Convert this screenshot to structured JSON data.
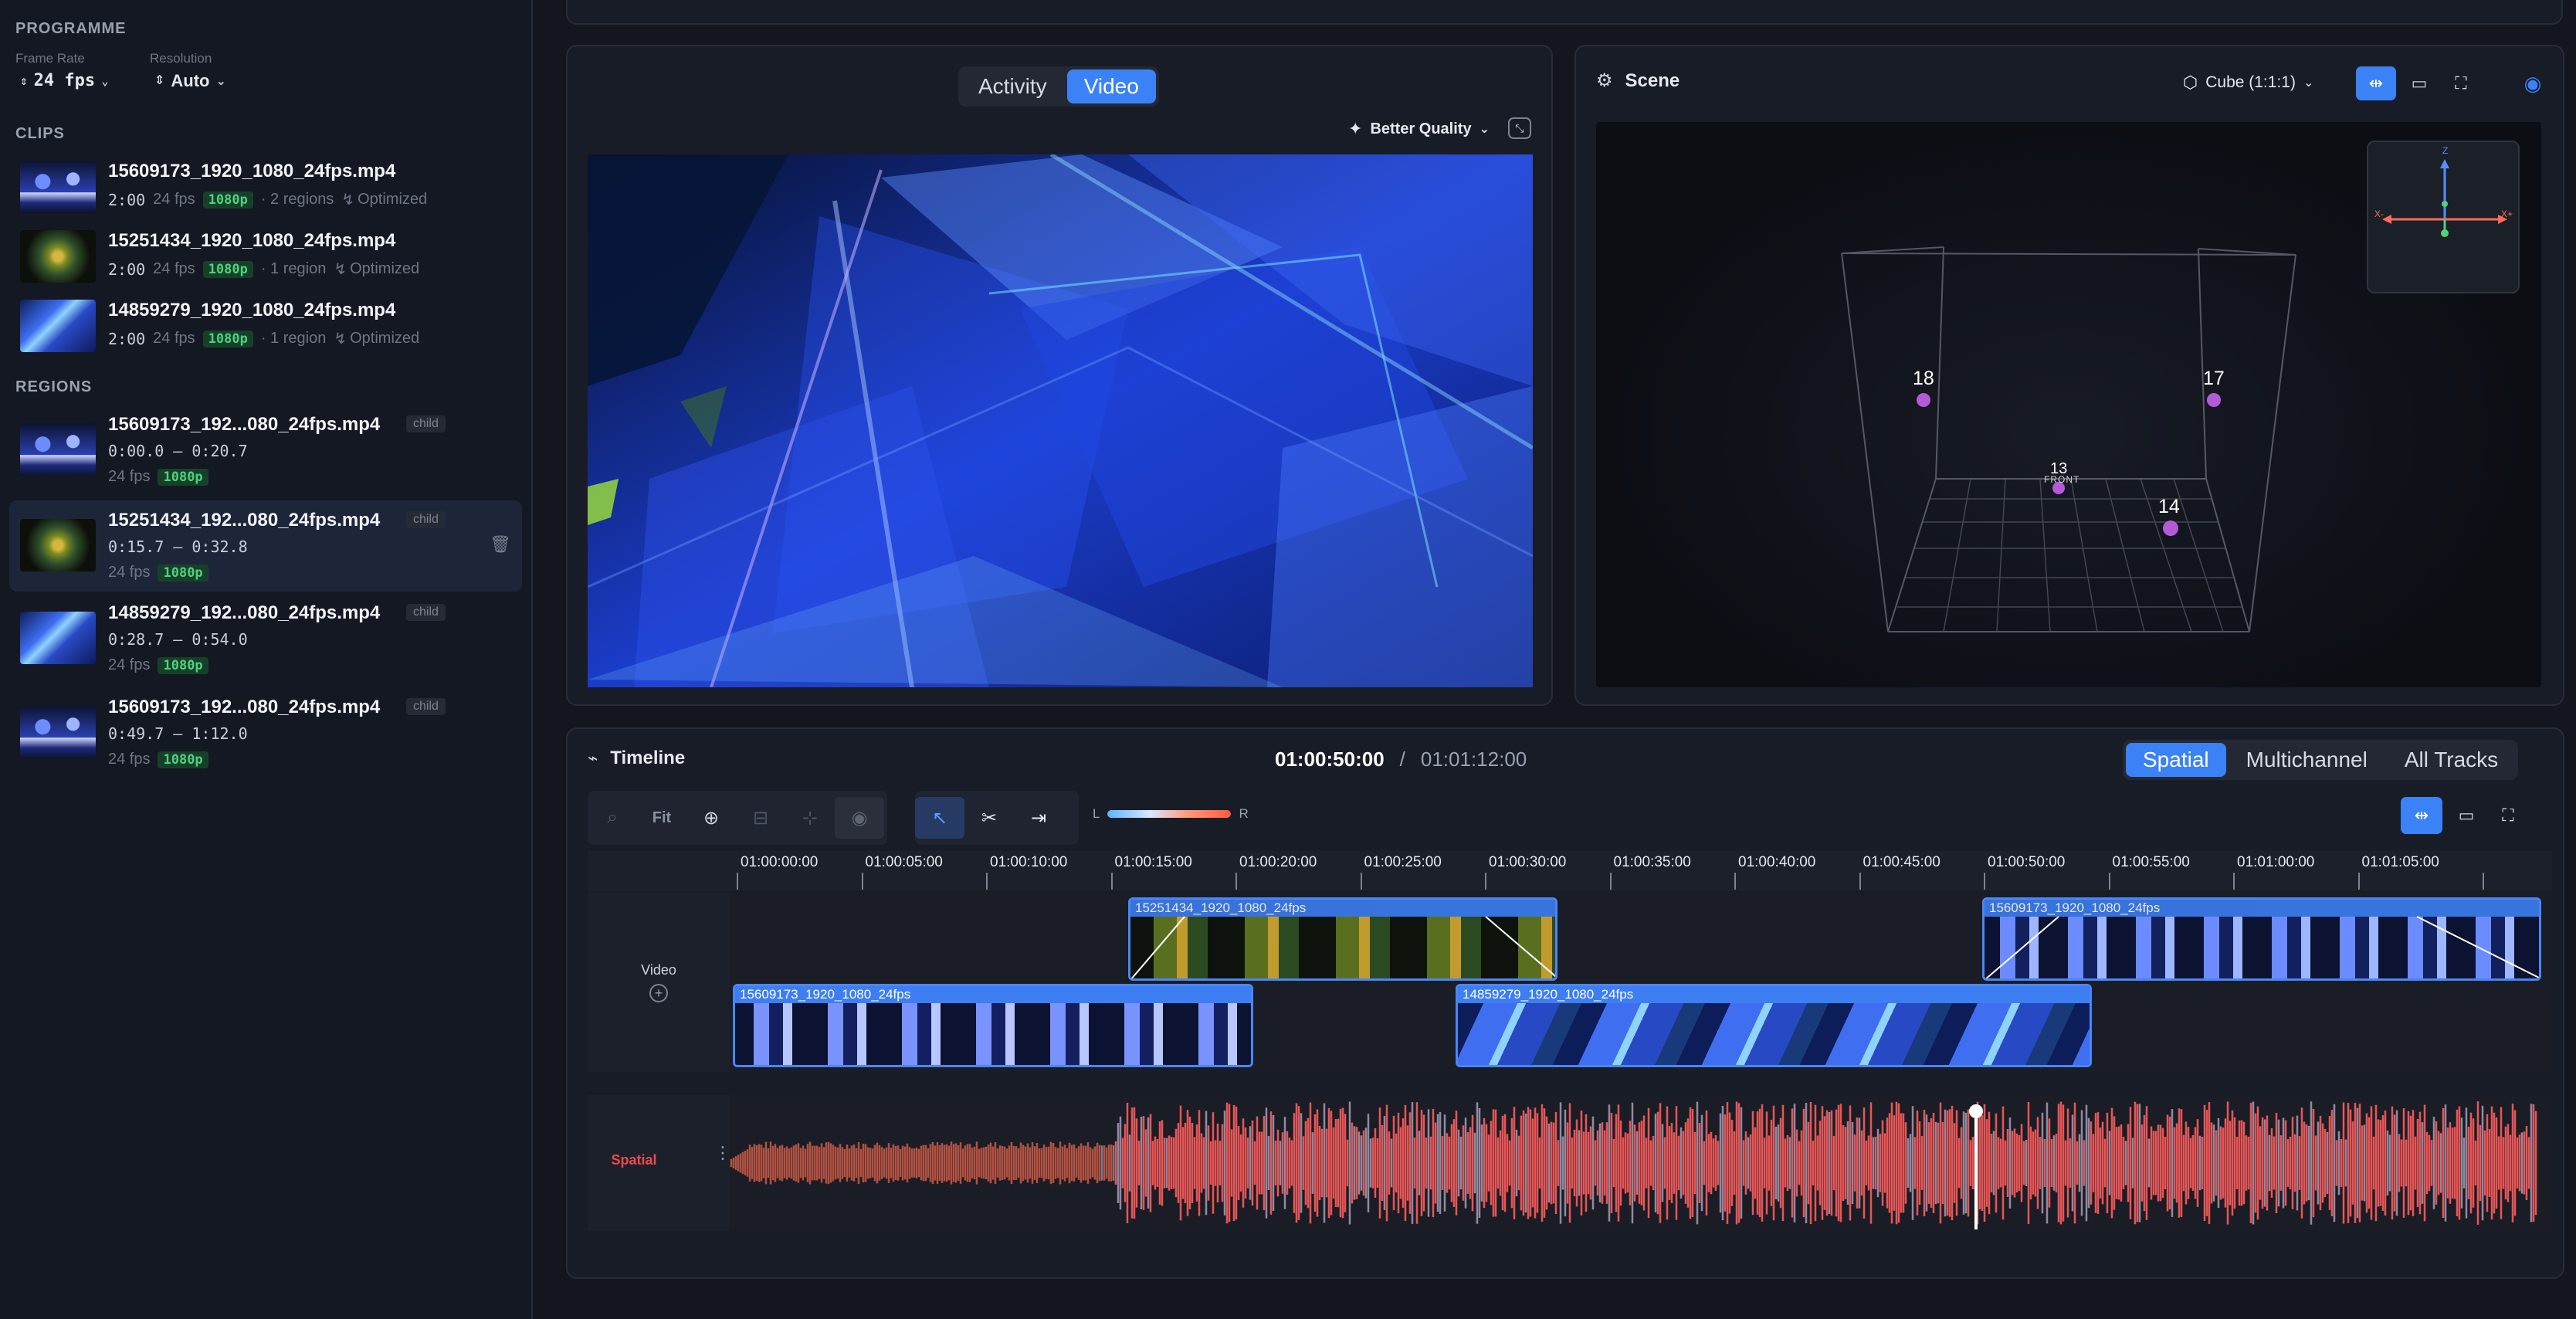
{
  "sidebar": {
    "programme": {
      "title": "PROGRAMME",
      "frame_rate_label": "Frame Rate",
      "frame_rate_value": "24 fps",
      "resolution_label": "Resolution",
      "resolution_value": "Auto"
    },
    "clips_title": "CLIPS",
    "clips": [
      {
        "name": "15609173_1920_1080_24fps.mp4",
        "duration": "2:00",
        "fps": "24 fps",
        "res": "1080p",
        "regions": "· 2 regions",
        "status": "Optimized"
      },
      {
        "name": "15251434_1920_1080_24fps.mp4",
        "duration": "2:00",
        "fps": "24 fps",
        "res": "1080p",
        "regions": "· 1 region",
        "status": "Optimized"
      },
      {
        "name": "14859279_1920_1080_24fps.mp4",
        "duration": "2:00",
        "fps": "24 fps",
        "res": "1080p",
        "regions": "· 1 region",
        "status": "Optimized"
      }
    ],
    "regions_title": "REGIONS",
    "regions": [
      {
        "name": "15609173_192...080_24fps.mp4",
        "badge": "child",
        "range": "0:00.0 – 0:20.7",
        "fps": "24 fps",
        "res": "1080p"
      },
      {
        "name": "15251434_192...080_24fps.mp4",
        "badge": "child",
        "range": "0:15.7 – 0:32.8",
        "fps": "24 fps",
        "res": "1080p"
      },
      {
        "name": "14859279_192...080_24fps.mp4",
        "badge": "child",
        "range": "0:28.7 – 0:54.0",
        "fps": "24 fps",
        "res": "1080p"
      },
      {
        "name": "15609173_192...080_24fps.mp4",
        "badge": "child",
        "range": "0:49.7 – 1:12.0",
        "fps": "24 fps",
        "res": "1080p"
      }
    ]
  },
  "video_panel": {
    "tabs": [
      "Activity",
      "Video"
    ],
    "active_tab": "Video",
    "quality": "Better Quality"
  },
  "scene_panel": {
    "title": "Scene",
    "shape": "Cube (1:1:1)",
    "points": [
      "18",
      "17",
      "13",
      "14"
    ],
    "front_label": "FRONT",
    "axes": {
      "z": "Z",
      "x_neg": "X-",
      "x_pos": "X+"
    }
  },
  "timeline": {
    "title": "Timeline",
    "current_time": "01:00:50:00",
    "separator": "/",
    "total_time": "01:01:12:00",
    "modes": [
      "Spatial",
      "Multichannel",
      "All Tracks"
    ],
    "active_mode": "Spatial",
    "fit_label": "Fit",
    "pan_l": "L",
    "pan_r": "R",
    "ruler": [
      "01:00:00:00",
      "01:00:05:00",
      "01:00:10:00",
      "01:00:15:00",
      "01:00:20:00",
      "01:00:25:00",
      "01:00:30:00",
      "01:00:35:00",
      "01:00:40:00",
      "01:00:45:00",
      "01:00:50:00",
      "01:00:55:00",
      "01:01:00:00",
      "01:01:05:00"
    ],
    "video_track_label": "Video",
    "audio_track_label": "Spatial",
    "clips": [
      {
        "label": "15251434_1920_1080_24fps",
        "lane": 1
      },
      {
        "label": "15609173_1920_1080_24fps",
        "lane": 1
      },
      {
        "label": "15609173_1920_1080_24fps",
        "lane": 2
      },
      {
        "label": "14859279_1920_1080_24fps",
        "lane": 2
      }
    ]
  },
  "colors": {
    "accent": "#3b82f6",
    "badge_green": "#4fd17e",
    "point_purple": "#b35ad6",
    "waveform_red": "#f25a5a",
    "spatial_label": "#f0484f"
  }
}
